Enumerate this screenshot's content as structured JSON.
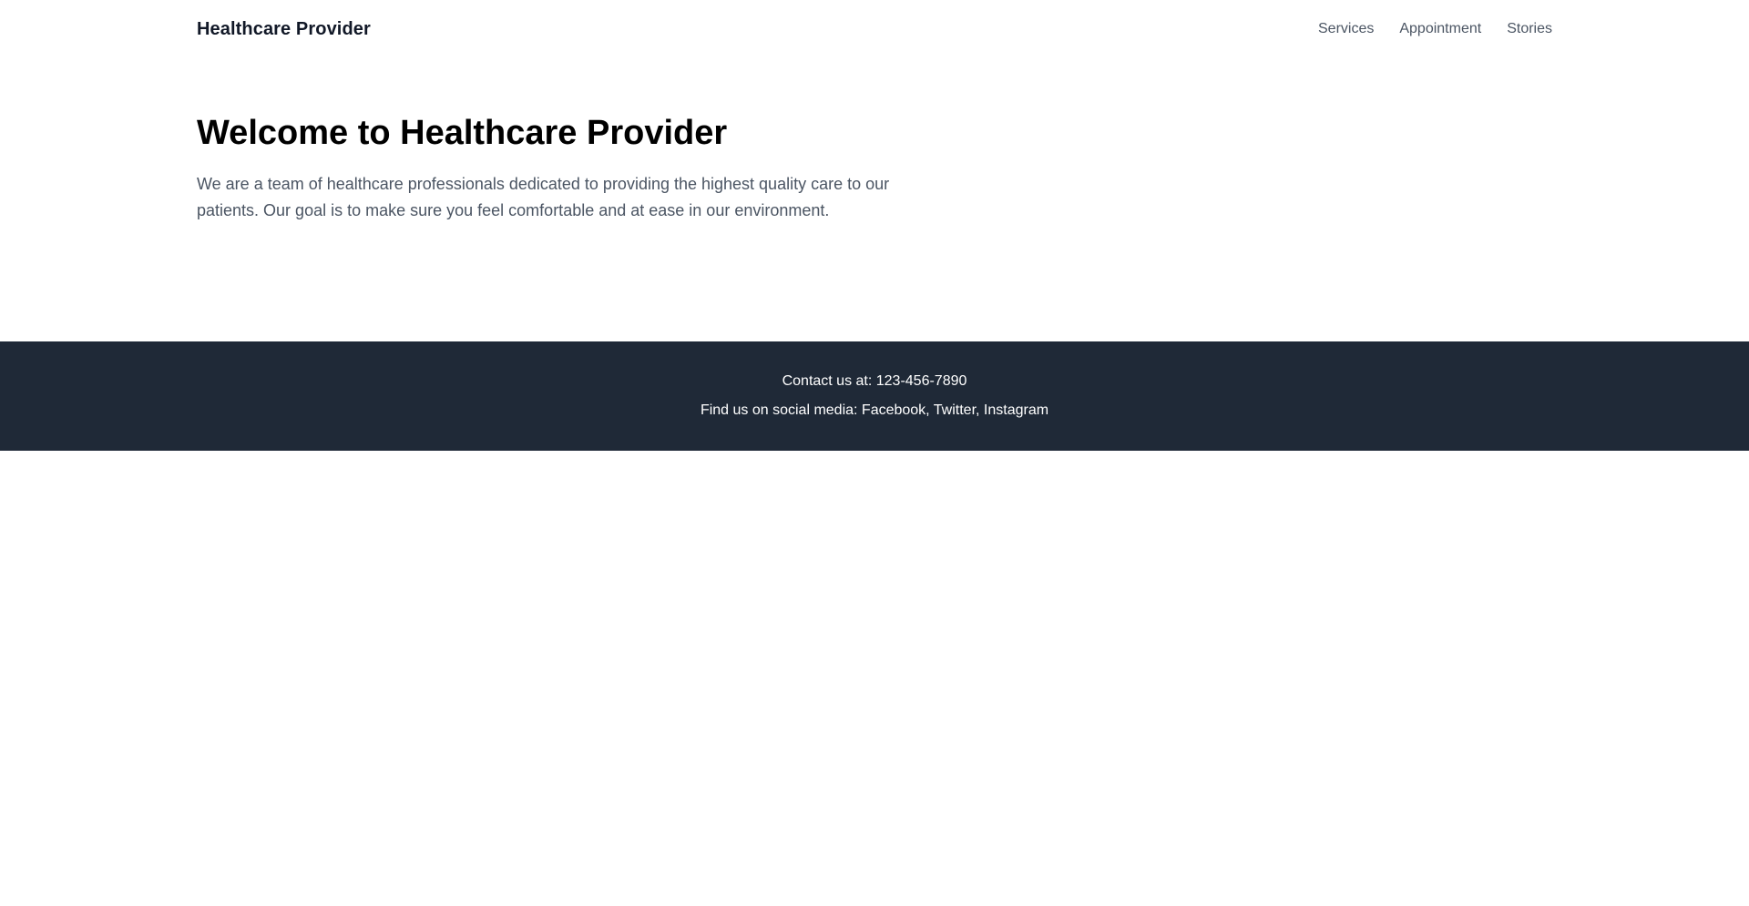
{
  "header": {
    "brand": "Healthcare Provider",
    "nav": [
      {
        "label": "Services"
      },
      {
        "label": "Appointment"
      },
      {
        "label": "Stories"
      }
    ]
  },
  "hero": {
    "title": "Welcome to Healthcare Provider",
    "text": "We are a team of healthcare professionals dedicated to providing the highest quality care to our patients. Our goal is to make sure you feel comfortable and at ease in our environment."
  },
  "footer": {
    "contact": "Contact us at: 123-456-7890",
    "social": "Find us on social media: Facebook, Twitter, Instagram"
  },
  "colors": {
    "footer_bg": "#1f2937",
    "nav_text": "#4b5563",
    "body_text": "#4b5563"
  }
}
